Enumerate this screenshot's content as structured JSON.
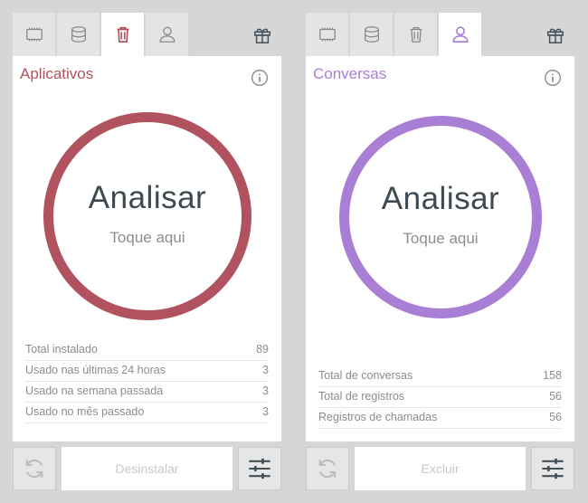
{
  "colors": {
    "accent_left": "#b1535f",
    "accent_right": "#a97fd6",
    "icon": "#888888",
    "icon_dark": "#445058"
  },
  "left": {
    "active_tab": "trash",
    "tabs": [
      "cpu-icon",
      "storage-icon",
      "trash-icon",
      "person-icon"
    ],
    "title": "Aplicativos",
    "ring_title": "Analisar",
    "ring_subtitle": "Toque aqui",
    "stats": [
      {
        "label": "Total instalado",
        "value": "89"
      },
      {
        "label": "Usado nas últimas 24 horas",
        "value": "3"
      },
      {
        "label": "Usado na semana passada",
        "value": "3"
      },
      {
        "label": "Usado no mês passado",
        "value": "3"
      }
    ],
    "action_label": "Desinstalar"
  },
  "right": {
    "active_tab": "person",
    "tabs": [
      "cpu-icon",
      "storage-icon",
      "trash-icon",
      "person-icon"
    ],
    "title": "Conversas",
    "ring_title": "Analisar",
    "ring_subtitle": "Toque aqui",
    "stats": [
      {
        "label": "Total de conversas",
        "value": "158"
      },
      {
        "label": "Total de registros",
        "value": "56"
      },
      {
        "label": "Registros de chamadas",
        "value": "56"
      }
    ],
    "action_label": "Excluir"
  }
}
